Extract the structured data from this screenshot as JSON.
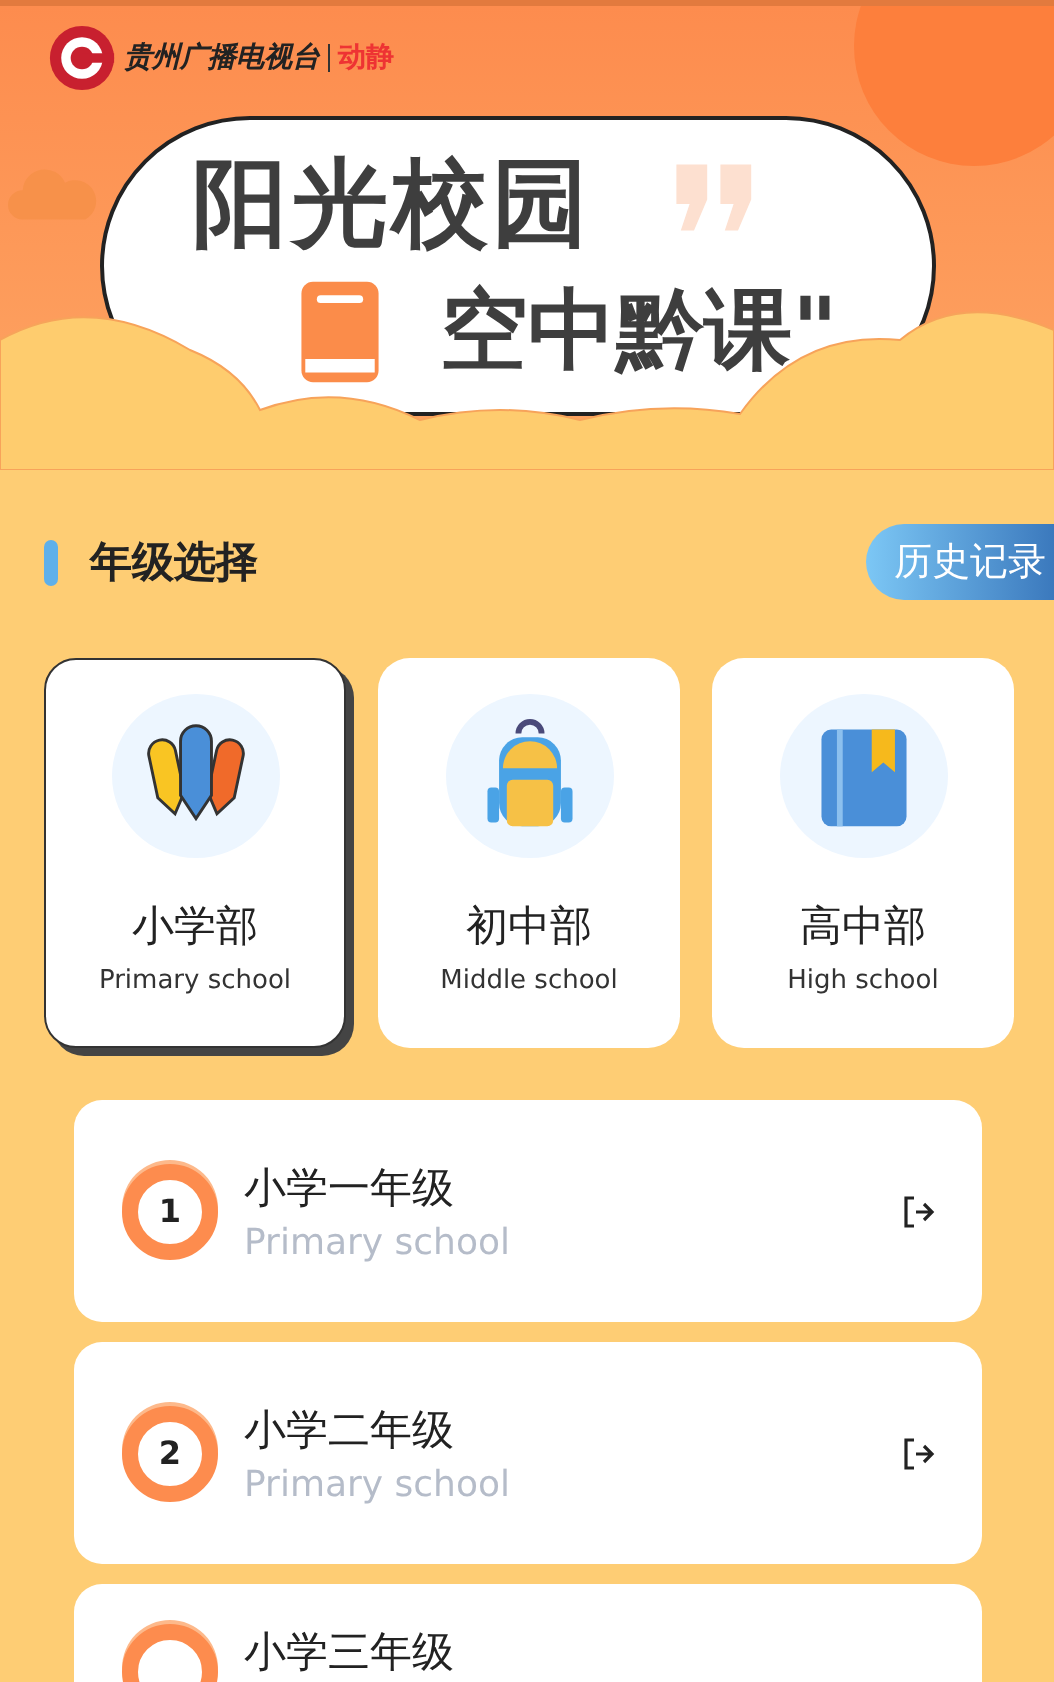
{
  "header": {
    "logo_text": "贵州广播电视台",
    "brand": "动静",
    "title_line_1": "阳光校园",
    "title_line_2": "空中黔课\""
  },
  "section": {
    "title": "年级选择",
    "history_button": "历史记录"
  },
  "levels": [
    {
      "name": "小学部",
      "subtitle": "Primary school",
      "selected": true,
      "kind": "pencils"
    },
    {
      "name": "初中部",
      "subtitle": "Middle school",
      "selected": false,
      "kind": "backpack"
    },
    {
      "name": "高中部",
      "subtitle": "High school",
      "selected": false,
      "kind": "book"
    }
  ],
  "grades": [
    {
      "number": "1",
      "name": "小学一年级",
      "subtitle": "Primary school"
    },
    {
      "number": "2",
      "name": "小学二年级",
      "subtitle": "Primary school"
    },
    {
      "name": "小学三年级"
    }
  ]
}
